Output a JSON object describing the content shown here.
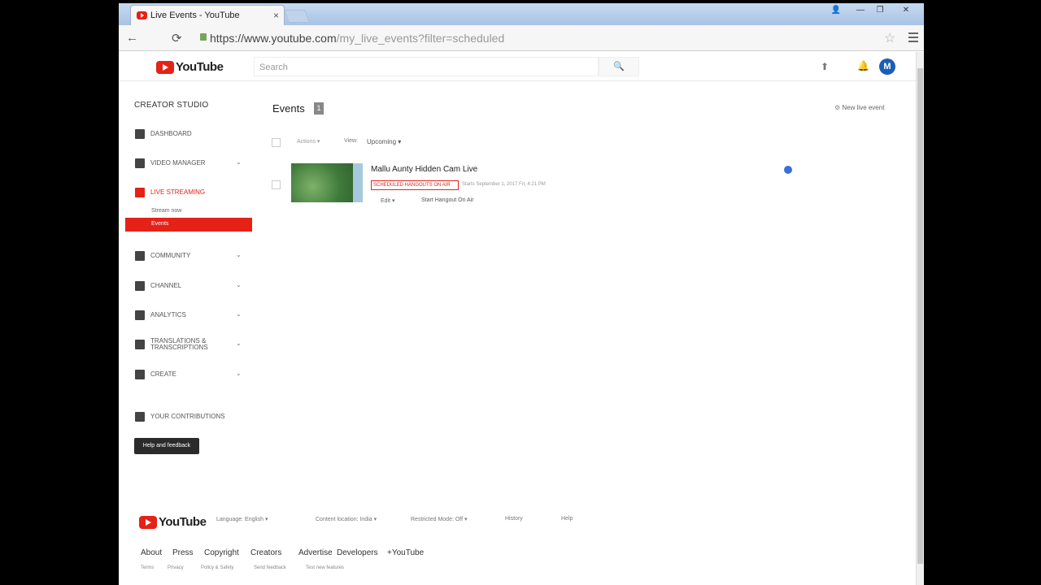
{
  "browser": {
    "tab_title": "Live Events - YouTube",
    "tab_close": "×",
    "url_host": "https://www.youtube.com",
    "url_path": "/my_live_events?filter=scheduled",
    "back_icon": "←",
    "reload_icon": "⟳",
    "star_icon": "☆",
    "win_user": "👤",
    "win_min": "—",
    "win_max": "❐",
    "win_close": "✕"
  },
  "header": {
    "logo_text": "YouTube",
    "search_placeholder": "Search",
    "search_icon": "🔍",
    "upload_icon": "⬆",
    "bell_icon": "🔔",
    "avatar_letter": "M"
  },
  "sidebar": {
    "title": "CREATOR STUDIO",
    "items": [
      {
        "label": "DASHBOARD"
      },
      {
        "label": "VIDEO MANAGER"
      },
      {
        "label": "LIVE STREAMING"
      },
      {
        "label": "COMMUNITY"
      },
      {
        "label": "CHANNEL"
      },
      {
        "label": "ANALYTICS"
      },
      {
        "label": "TRANSLATIONS & TRANSCRIPTIONS"
      },
      {
        "label": "CREATE"
      },
      {
        "label": "YOUR CONTRIBUTIONS"
      }
    ],
    "sub_items": [
      "Stream now",
      "Events"
    ],
    "chevron": "⌄",
    "help_button": "Help and feedback"
  },
  "main": {
    "title": "Events",
    "count": "1",
    "new_event": "New live event",
    "filter_actions": "Actions ▾",
    "filter_view": "View:",
    "filter_upcoming": "Upcoming ▾",
    "event": {
      "title": "Mallu Aunty Hidden Cam Live",
      "badge": "SCHEDULED HANGOUTS ON AIR",
      "schedule": "Starts September 1, 2017 Fri, 4:21 PM",
      "edit": "Edit ▾",
      "hangout": "Start Hangout On Air"
    }
  },
  "footer": {
    "logo_text": "YouTube",
    "language": "Language: English ▾",
    "location": "Content location: India ▾",
    "restricted": "Restricted Mode: Off ▾",
    "history": "History",
    "help": "Help",
    "links": [
      "About",
      "Press",
      "Copyright",
      "Creators",
      "Advertise",
      "Developers",
      "+YouTube"
    ],
    "small_links": [
      "Terms",
      "Privacy",
      "Policy & Safety",
      "Send feedback",
      "Test new features"
    ]
  },
  "colors": {
    "brand_red": "#e62117",
    "avatar_blue": "#1a5fb4"
  }
}
